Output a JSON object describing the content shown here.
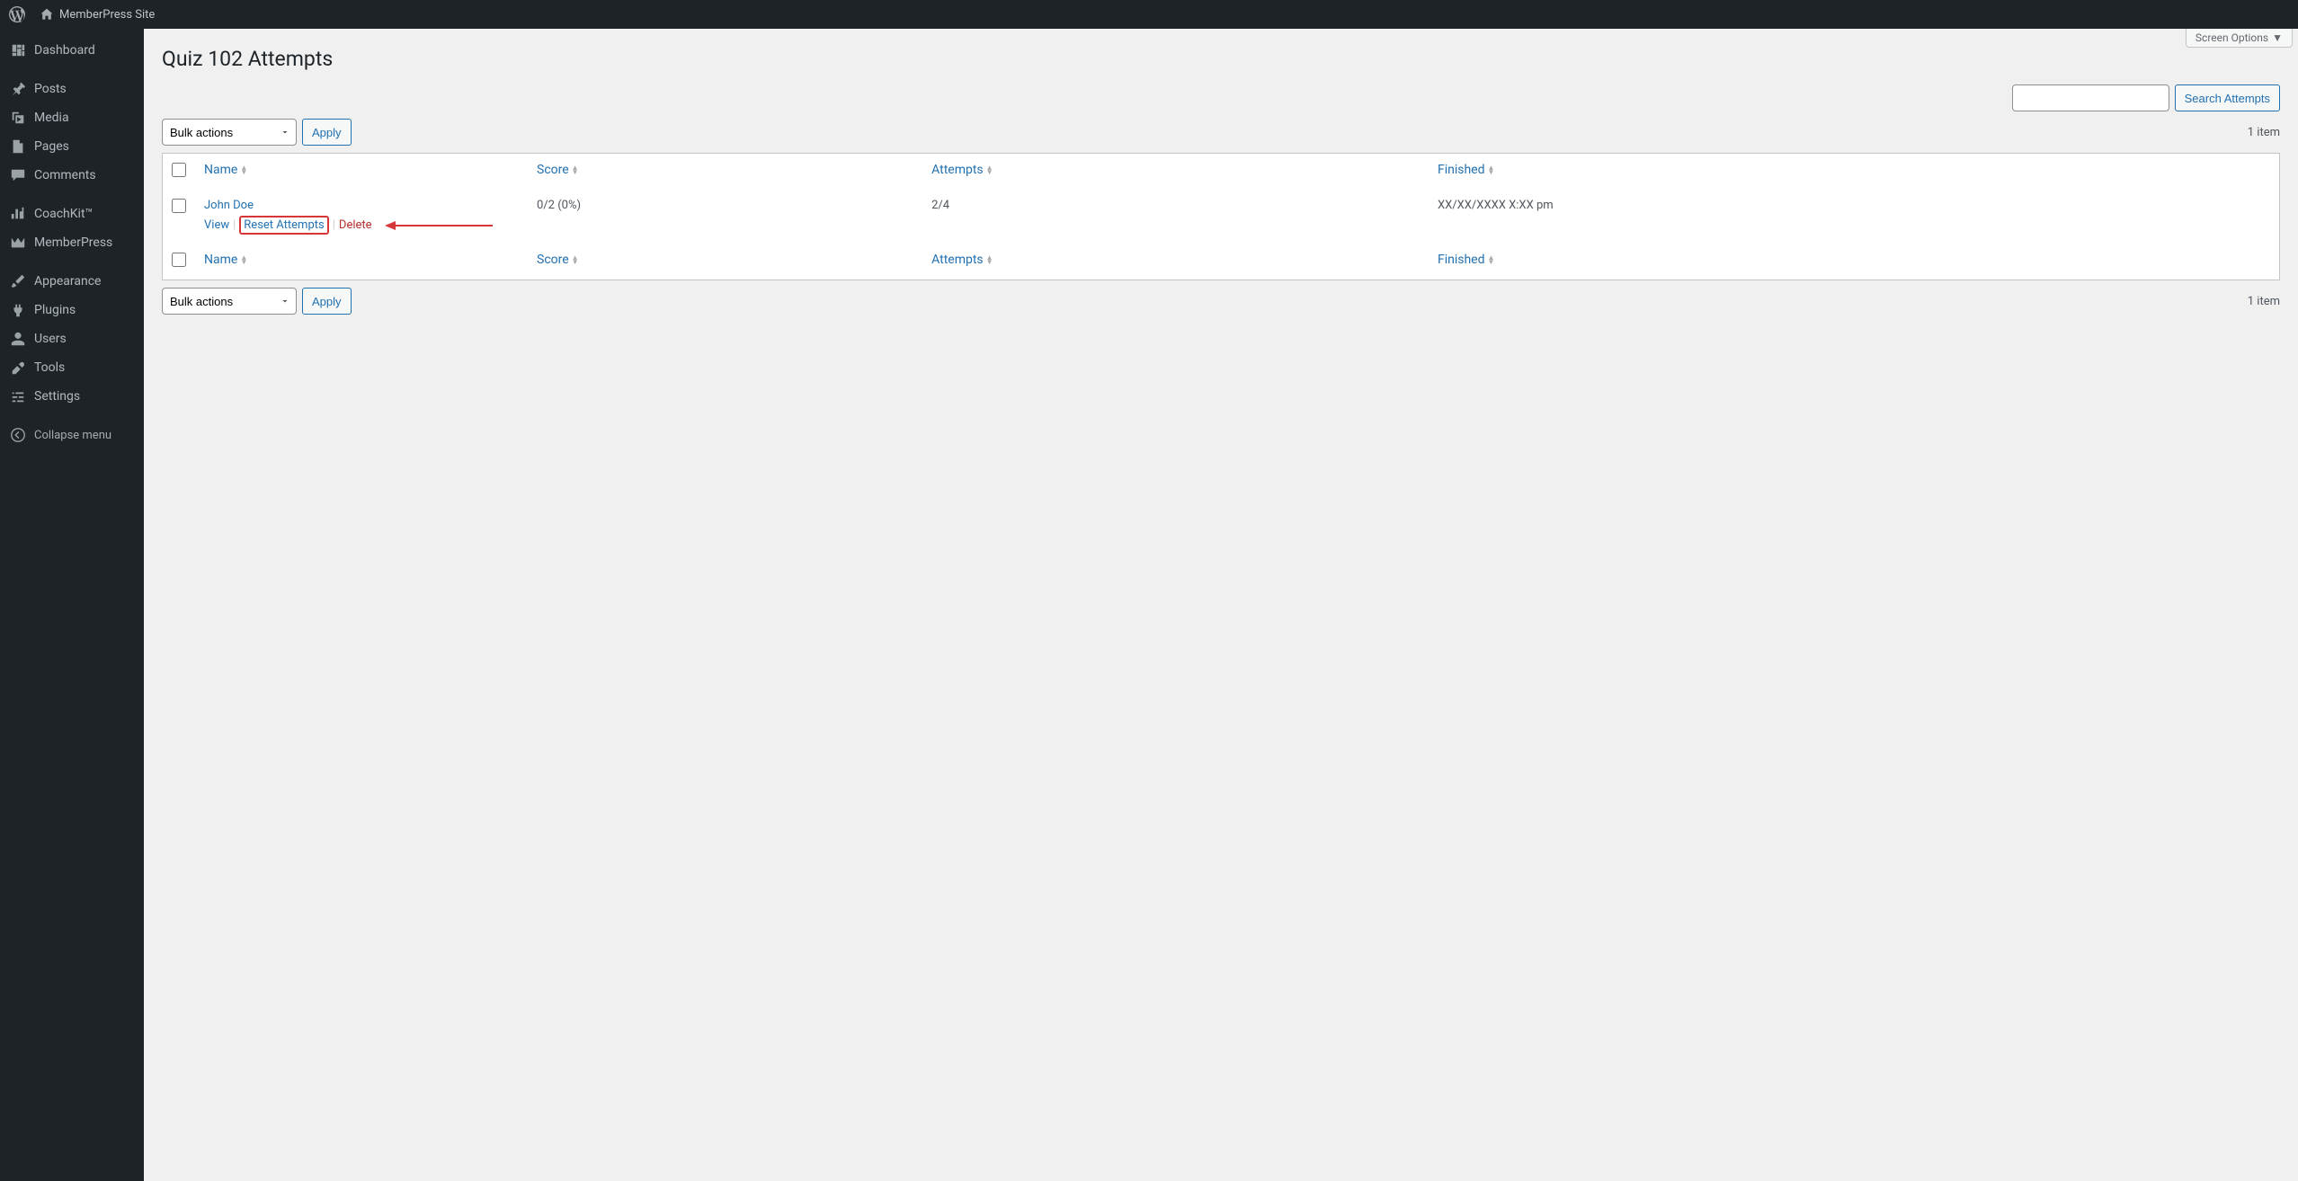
{
  "adminBar": {
    "siteName": "MemberPress Site"
  },
  "sidebar": {
    "items": [
      {
        "label": "Dashboard"
      },
      {
        "label": "Posts"
      },
      {
        "label": "Media"
      },
      {
        "label": "Pages"
      },
      {
        "label": "Comments"
      },
      {
        "label": "CoachKit™"
      },
      {
        "label": "MemberPress"
      },
      {
        "label": "Appearance"
      },
      {
        "label": "Plugins"
      },
      {
        "label": "Users"
      },
      {
        "label": "Tools"
      },
      {
        "label": "Settings"
      }
    ],
    "collapseLabel": "Collapse menu"
  },
  "header": {
    "screenOptions": "Screen Options",
    "pageTitle": "Quiz 102 Attempts"
  },
  "search": {
    "buttonLabel": "Search Attempts"
  },
  "bulk": {
    "placeholder": "Bulk actions",
    "applyLabel": "Apply"
  },
  "table": {
    "columns": {
      "name": "Name",
      "score": "Score",
      "attempts": "Attempts",
      "finished": "Finished"
    },
    "rows": [
      {
        "name": "John Doe",
        "score": "0/2 (0%)",
        "attempts": "2/4",
        "finished": "XX/XX/XXXX X:XX pm",
        "actions": {
          "view": "View",
          "reset": "Reset Attempts",
          "delete": "Delete"
        }
      }
    ]
  },
  "pagination": {
    "countText": "1 item"
  }
}
